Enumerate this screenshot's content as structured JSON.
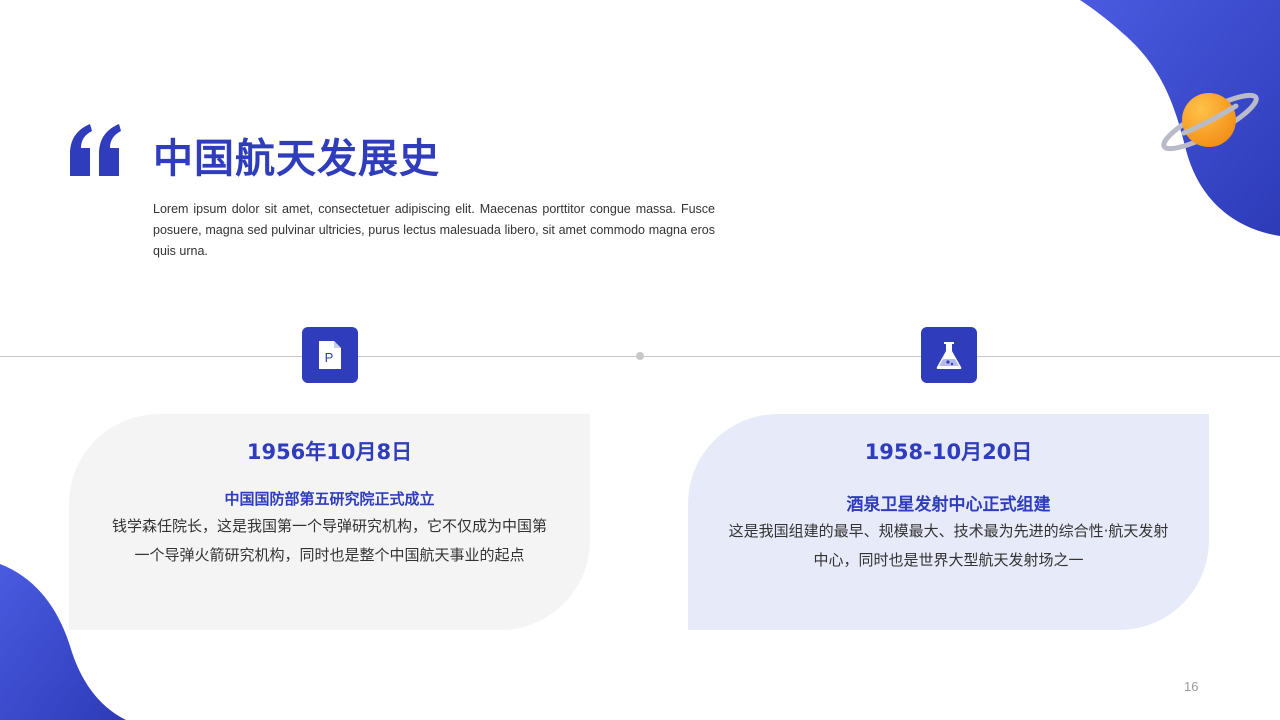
{
  "header": {
    "title": "中国航天发展史",
    "intro": "Lorem ipsum dolor sit amet, consectetuer adipiscing elit. Maecenas porttitor congue massa. Fusce posuere, magna sed pulvinar ultricies, purus lectus malesuada libero, sit amet commodo magna eros quis urna."
  },
  "timeline": {
    "events": [
      {
        "icon": "document-p-icon",
        "date": "1956年10月8日",
        "heading": "中国国防部第五研究院正式成立",
        "body": "钱学森任院长，这是我国第一个导弹研究机构，它不仅成为中国第一个导弹火箭研究机构，同时也是整个中国航天事业的起点"
      },
      {
        "icon": "flask-icon",
        "date": "1958-10月20日",
        "heading": "酒泉卫星发射中心正式组建",
        "body": "这是我国组建的最早、规模最大、技术最为先进的综合性·航天发射中心，同时也是世界大型航天发射场之一"
      }
    ]
  },
  "footer": {
    "page_number": "16"
  },
  "colors": {
    "accent": "#2f3dbd",
    "card_gray": "#f4f4f4",
    "card_blue": "#e7eaf8",
    "planet": "#f7a51f"
  }
}
